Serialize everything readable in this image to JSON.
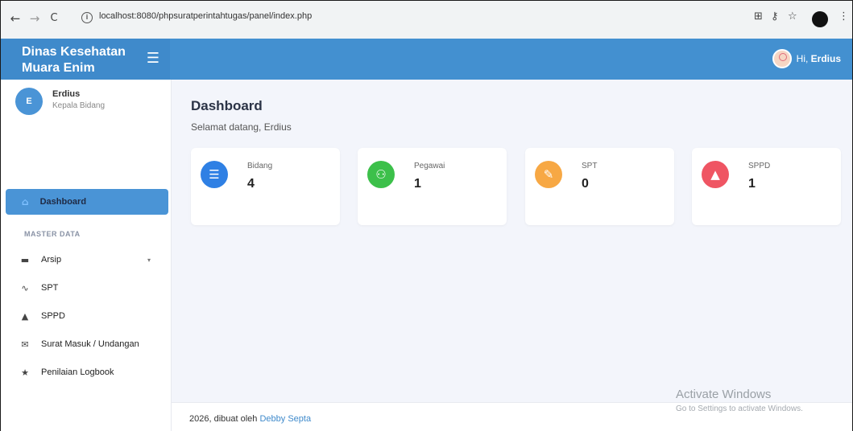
{
  "browser": {
    "back_icon": "←",
    "forward_icon": "→",
    "reload_icon": "C",
    "info_icon": "i",
    "url": "localhost:8080/phpsuratperintahtugas/panel/index.php",
    "translate_icon": "⊞",
    "key_icon": "⚷",
    "star_icon": "☆",
    "menu_icon": "⋮"
  },
  "header": {
    "brand": "Dinas Kesehatan Muara Enim",
    "hamburger_icon": "☰",
    "greeting_prefix": "Hi, ",
    "user_name": "Erdius"
  },
  "sidebar": {
    "profile_initial": "E",
    "profile_name": "Erdius",
    "profile_role": "Kepala Bidang",
    "active_item": {
      "label": "Dashboard",
      "icon": "⌂"
    },
    "section_label": "MASTER DATA",
    "items": [
      {
        "label": "Arsip",
        "icon": "▬",
        "caret": "▾"
      },
      {
        "label": "SPT",
        "icon": "∿"
      },
      {
        "label": "SPPD",
        "icon": "▲"
      },
      {
        "label": "Surat Masuk / Undangan",
        "icon": "✉"
      },
      {
        "label": "Penilaian Logbook",
        "icon": "★"
      }
    ]
  },
  "main": {
    "title": "Dashboard",
    "subtitle": "Selamat datang, Erdius",
    "cards": [
      {
        "label": "Bidang",
        "value": "4",
        "color": "#2f80e4",
        "icon": "☰"
      },
      {
        "label": "Pegawai",
        "value": "1",
        "color": "#3cc04a",
        "icon": "⚇"
      },
      {
        "label": "SPT",
        "value": "0",
        "color": "#f7a844",
        "icon": "✎"
      },
      {
        "label": "SPPD",
        "value": "1",
        "color": "#ef5563",
        "icon": "▲"
      }
    ]
  },
  "footer": {
    "text": "2026, dibuat oleh ",
    "link": "Debby Septa"
  },
  "watermark": {
    "title": "Activate Windows",
    "subtitle": "Go to Settings to activate Windows."
  }
}
